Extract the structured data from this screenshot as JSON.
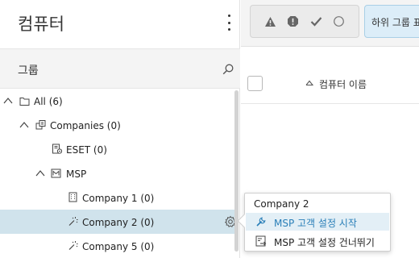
{
  "left_panel": {
    "title": "컴퓨터",
    "group_section_label": "그룹"
  },
  "tree": {
    "items": [
      {
        "label": "All (6)",
        "icon": "folder-icon",
        "expanded": true
      },
      {
        "label": "Companies (0)",
        "icon": "companies-icon",
        "expanded": true
      },
      {
        "label": "ESET (0)",
        "icon": "eset-company-icon"
      },
      {
        "label": "MSP",
        "icon": "msp-icon",
        "expanded": true
      },
      {
        "label": "Company 1 (0)",
        "icon": "building-icon"
      },
      {
        "label": "Company 2 (0)",
        "icon": "wand-icon",
        "selected": true
      },
      {
        "label": "Company 5 (0)",
        "icon": "wand-icon"
      }
    ]
  },
  "toolbar": {
    "filters": [
      "warning-icon",
      "error-icon",
      "ok-check-icon",
      "circle-icon"
    ],
    "subgroup_button_label": "하위 그룹 표"
  },
  "list": {
    "column_name": "컴퓨터 이름"
  },
  "context_menu": {
    "title": "Company 2",
    "items": [
      {
        "label": "MSP 고객 설정 시작",
        "icon": "wrench-icon",
        "highlighted": true
      },
      {
        "label": "MSP 고객 설정 건너뛰기",
        "icon": "skip-setup-icon"
      }
    ]
  },
  "colors": {
    "selected_row": "#d0e3ec",
    "menu_highlight_text": "#2a7fb8",
    "subgroup_button_bg": "#dcedf8"
  }
}
